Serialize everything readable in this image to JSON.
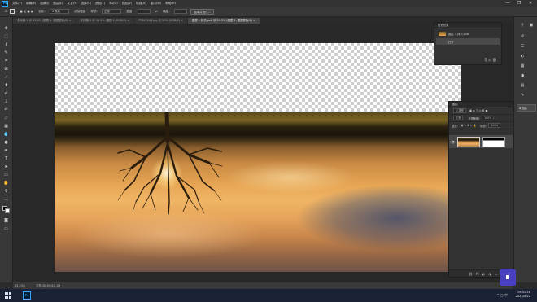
{
  "app": {
    "logo": "Ps",
    "accent": "#31a8ff"
  },
  "menu": {
    "items": [
      "文件(F)",
      "编辑(E)",
      "图像(I)",
      "图层(L)",
      "文字(Y)",
      "选择(S)",
      "滤镜(T)",
      "3D(D)",
      "视图(V)",
      "增强(X)",
      "窗口(W)",
      "帮助(H)"
    ]
  },
  "window_controls": {
    "minimize": "—",
    "maximize": "❐",
    "close": "✕"
  },
  "options_bar": {
    "feather_label": "羽化：",
    "feather_value": "0 像素",
    "antialias_label": "消除锯齿",
    "style_label": "样式：",
    "style_value": "正常",
    "width_label": "宽度：",
    "height_label": "高度：",
    "select_button": "选择并遮住..."
  },
  "tabs": [
    {
      "label": "未标题-1 @ 33.3% (图层 1, 图层蒙版/8) ×",
      "active": false
    },
    {
      "label": "未标题-1 @ 33.3% (图层 1, RGB/8) ×",
      "active": false
    },
    {
      "label": "7T8A1043.jpg @ 50% (RGB/8) ×",
      "active": false
    },
    {
      "label": "图层 1 拷贝.psb @ 33.3% (图层 1, 图层蒙版/8) ×",
      "active": true
    }
  ],
  "history_panel": {
    "title": "历史记录",
    "rows": [
      {
        "label": "图层 1 拷贝.psb",
        "selected": false
      },
      {
        "label": "打开",
        "selected": true
      }
    ]
  },
  "layers_panel": {
    "title": "图层",
    "kind_label": "Q 类型",
    "mode_value": "正常",
    "opacity_label": "不透明度:",
    "opacity_value": "100%",
    "lock_label": "锁定:",
    "fill_label": "填充:",
    "fill_value": "100%",
    "eye": "👁",
    "footer_icons": [
      "⛓",
      "fx",
      "◐",
      "◑",
      "▭",
      "⊞",
      "🗑"
    ]
  },
  "right_dock": {
    "layers_button": "图层"
  },
  "status": {
    "zoom": "33.33%",
    "doc": "文档:30.5M/41.1M"
  },
  "taskbar": {
    "time": "19:31:26",
    "date": "2023/4/22",
    "tray": "⌃ ▢ 中"
  },
  "colors": {
    "foreground": "#000000",
    "background": "#ffffff"
  }
}
